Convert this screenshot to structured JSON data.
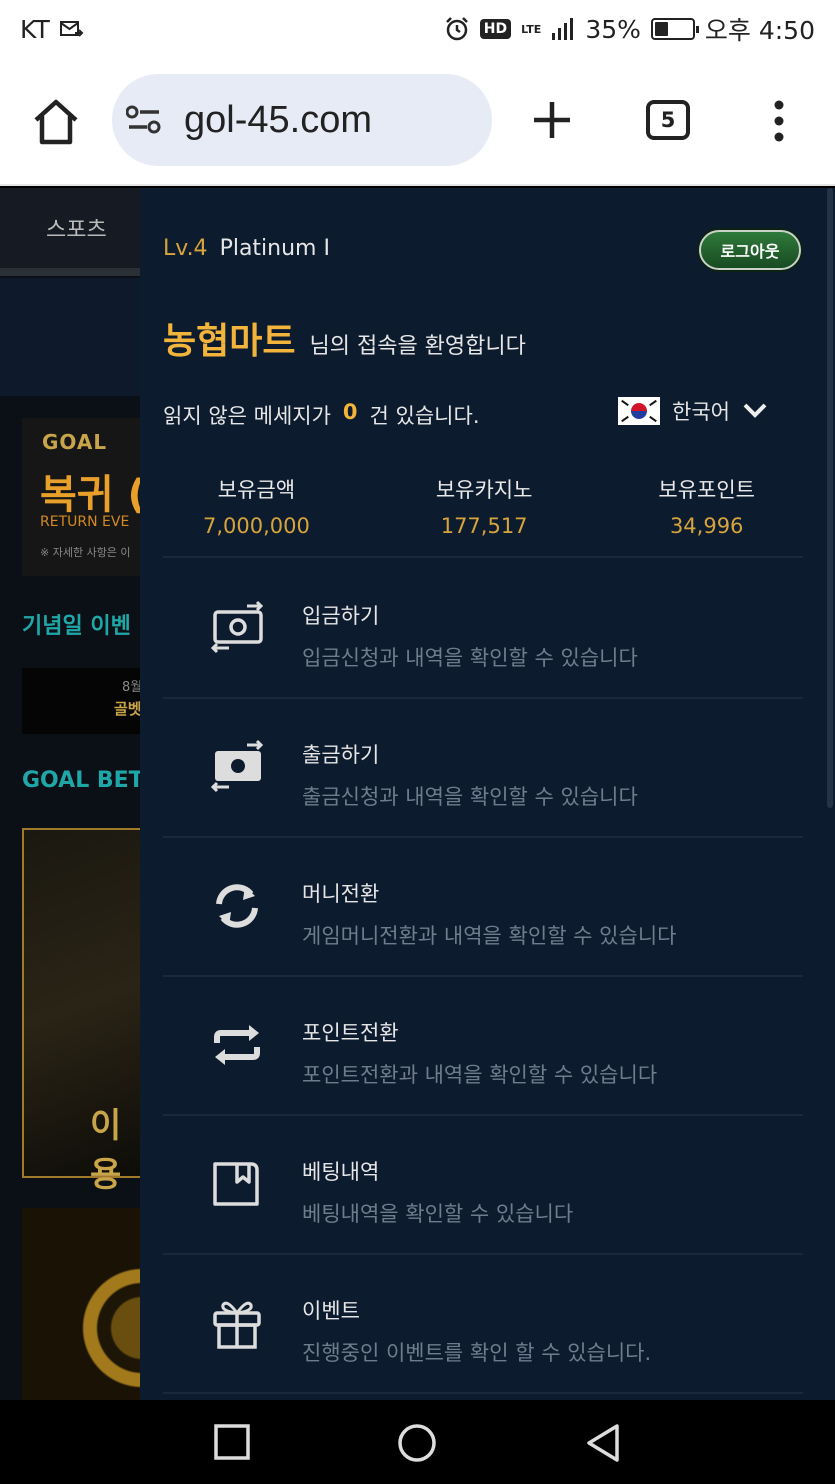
{
  "status_bar": {
    "carrier": "KT",
    "network": "LTE",
    "battery_level": "35%",
    "time": "오후 4:50",
    "hd_badge": "HD",
    "battery_fraction": 0.35
  },
  "browser": {
    "url": "gol-45.com",
    "tab_count": "5"
  },
  "background_page": {
    "nav_label": "스포츠",
    "banner_logo": "GOAL",
    "banner_title": "복귀 (",
    "banner_subtitle": "RETURN EVE",
    "banner_note": "※ 자세한 사항은 이",
    "section1": "기념일 이벤",
    "strip_top": "8월",
    "strip_bottom": "골벳",
    "section2": "GOAL BET",
    "promo_text": "이용"
  },
  "drawer": {
    "level": "Lv.4",
    "tier": "Platinum I",
    "logout_label": "로그아웃",
    "welcome_name": "농협마트",
    "welcome_text": "님의 접속을 환영합니다",
    "message_prefix": "읽지 않은 메세지가",
    "message_count": "0",
    "message_suffix": "건 있습니다.",
    "language": "한국어",
    "balances": [
      {
        "label": "보유금액",
        "value": "7,000,000"
      },
      {
        "label": "보유카지노",
        "value": "177,517"
      },
      {
        "label": "보유포인트",
        "value": "34,996"
      }
    ],
    "menu": [
      {
        "title": "입금하기",
        "desc": "입금신청과 내역을 확인할 수 있습니다",
        "icon": "deposit-icon"
      },
      {
        "title": "출금하기",
        "desc": "출금신청과 내역을 확인할 수 있습니다",
        "icon": "withdraw-icon"
      },
      {
        "title": "머니전환",
        "desc": "게임머니전환과 내역을 확인할 수 있습니다",
        "icon": "refresh-icon"
      },
      {
        "title": "포인트전환",
        "desc": "포인트전환과 내역을 확인할 수 있습니다",
        "icon": "swap-icon"
      },
      {
        "title": "베팅내역",
        "desc": "베팅내역을 확인할 수 있습니다",
        "icon": "bookmark-book-icon"
      },
      {
        "title": "이벤트",
        "desc": "진행중인 이벤트를 확인 할 수 있습니다.",
        "icon": "gift-icon"
      }
    ]
  }
}
